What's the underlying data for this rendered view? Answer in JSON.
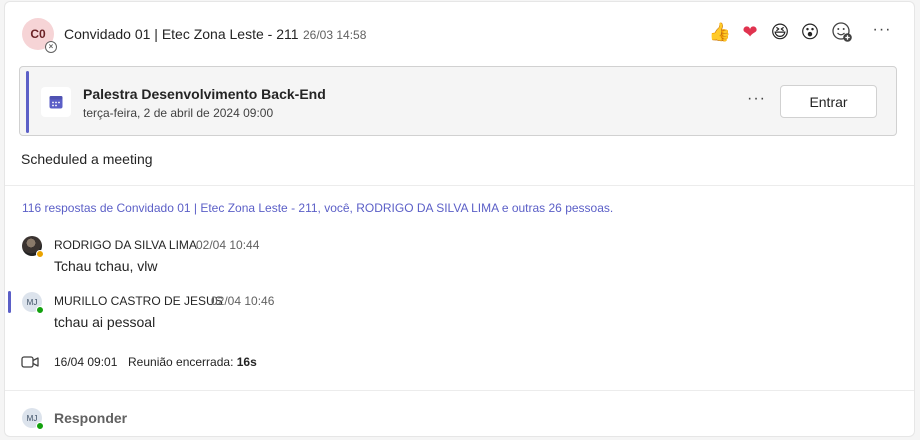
{
  "header": {
    "avatar_initials": "C0",
    "sender": "Convidado 01 | Etec Zona Leste - 211",
    "timestamp": "26/03 14:58",
    "reactions": [
      {
        "name": "like",
        "glyph": "👍"
      },
      {
        "name": "heart",
        "glyph": "❤"
      },
      {
        "name": "laugh",
        "glyph": "😆"
      },
      {
        "name": "surprised",
        "glyph": "😮"
      }
    ],
    "more_label": "···"
  },
  "meeting": {
    "title": "Palestra Desenvolvimento Back-End",
    "date": "terça-feira, 2 de abril de 2024 09:00",
    "more_label": "···",
    "join_label": "Entrar"
  },
  "message": {
    "text": "Scheduled a meeting"
  },
  "thread": {
    "summary": "116 respostas de Convidado 01 | Etec Zona Leste - 211, você, RODRIGO DA SILVA LIMA e outras 26 pessoas.",
    "replies": [
      {
        "name": "RODRIGO DA SILVA LIMA",
        "time": "02/04 10:44",
        "text": "Tchau tchau, vlw",
        "presence": "away"
      },
      {
        "name": "MURILLO CASTRO DE JESUS",
        "initials": "MJ",
        "time": "02/04 10:46",
        "text": "tchau ai pessoal",
        "presence": "online"
      }
    ],
    "meeting_ended": {
      "date": "16/04 09:01",
      "label": "Reunião encerrada:",
      "duration": "16s"
    }
  },
  "reply_box": {
    "avatar_initials": "MJ",
    "label": "Responder"
  },
  "colors": {
    "accent": "#5b5fc7",
    "online": "#13a10e",
    "away": "#eaa300"
  }
}
